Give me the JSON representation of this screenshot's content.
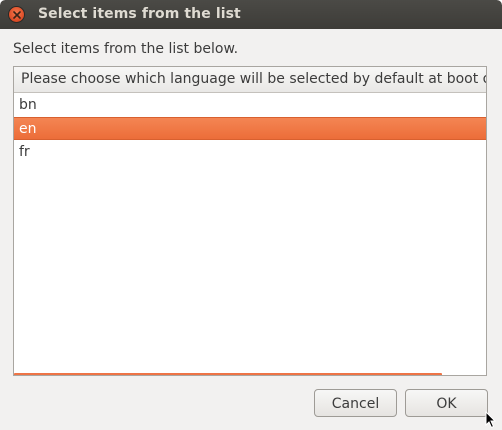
{
  "window": {
    "title": "Select items from the list"
  },
  "dialog": {
    "prompt": "Select items from the list below.",
    "column_header": "Please choose which language will be selected by default at boot of live",
    "items": [
      {
        "label": "bn",
        "selected": false
      },
      {
        "label": "en",
        "selected": true
      },
      {
        "label": "fr",
        "selected": false
      }
    ]
  },
  "buttons": {
    "cancel": "Cancel",
    "ok": "OK"
  },
  "colors": {
    "accent": "#ec6d39",
    "titlebar": "#3d3c38",
    "background": "#f2f1f0"
  },
  "icons": {
    "close": "close-icon",
    "cursor": "mouse-cursor-icon"
  }
}
